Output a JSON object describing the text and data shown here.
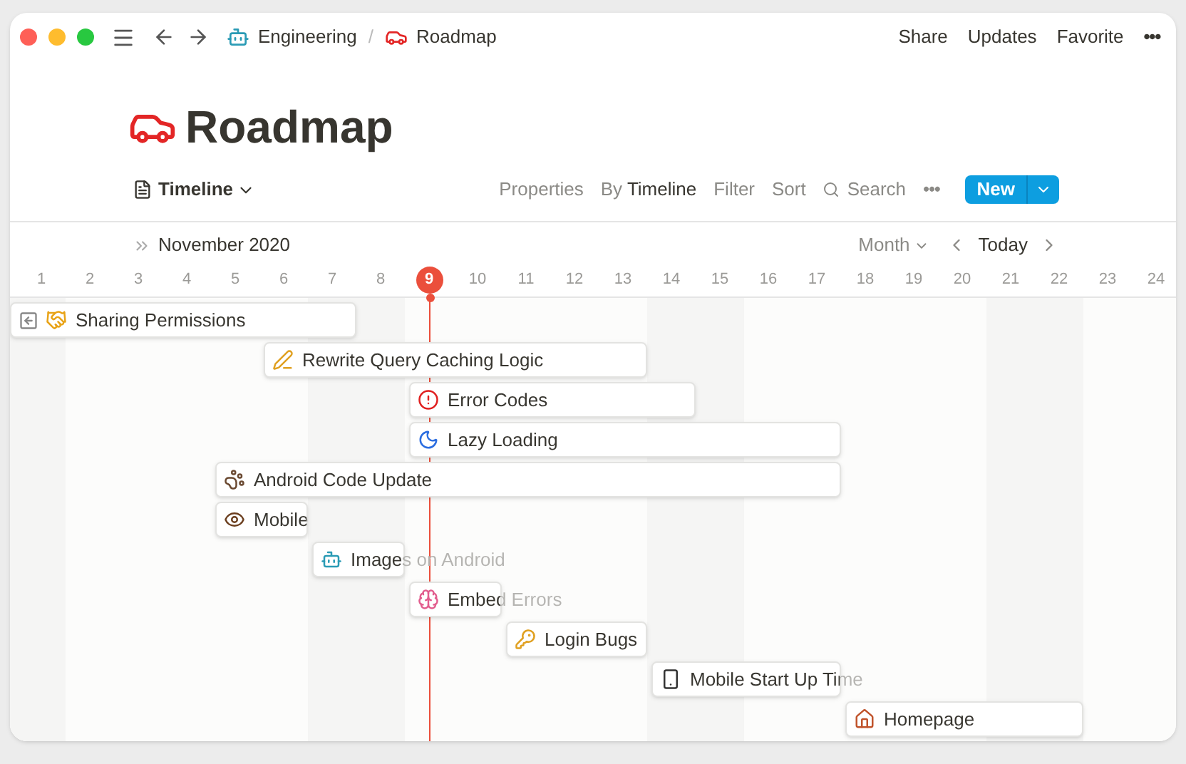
{
  "breadcrumb_separator": "/",
  "breadcrumb": [
    {
      "label": "Engineering"
    },
    {
      "label": "Roadmap"
    }
  ],
  "top_actions": [
    "Share",
    "Updates",
    "Favorite"
  ],
  "more": "•••",
  "title": "Roadmap",
  "view": {
    "label": "Timeline"
  },
  "toolbar": {
    "properties": "Properties",
    "group_prefix": "By",
    "group_value": "Timeline",
    "filter": "Filter",
    "sort": "Sort",
    "search": "Search",
    "more": "•••",
    "new": "New"
  },
  "month": "November 2020",
  "zoom": "Month",
  "today": "Today",
  "days": [
    {
      "label": "1",
      "weekend": true,
      "today": false
    },
    {
      "label": "2",
      "weekend": false,
      "today": false
    },
    {
      "label": "3",
      "weekend": false,
      "today": false
    },
    {
      "label": "4",
      "weekend": false,
      "today": false
    },
    {
      "label": "5",
      "weekend": false,
      "today": false
    },
    {
      "label": "6",
      "weekend": false,
      "today": false
    },
    {
      "label": "7",
      "weekend": true,
      "today": false
    },
    {
      "label": "8",
      "weekend": true,
      "today": false
    },
    {
      "label": "9",
      "weekend": false,
      "today": true
    },
    {
      "label": "10",
      "weekend": false,
      "today": false
    },
    {
      "label": "11",
      "weekend": false,
      "today": false
    },
    {
      "label": "12",
      "weekend": false,
      "today": false
    },
    {
      "label": "13",
      "weekend": false,
      "today": false
    },
    {
      "label": "14",
      "weekend": true,
      "today": false
    },
    {
      "label": "15",
      "weekend": true,
      "today": false
    },
    {
      "label": "16",
      "weekend": false,
      "today": false
    },
    {
      "label": "17",
      "weekend": false,
      "today": false
    },
    {
      "label": "18",
      "weekend": false,
      "today": false
    },
    {
      "label": "19",
      "weekend": false,
      "today": false
    },
    {
      "label": "20",
      "weekend": false,
      "today": false
    },
    {
      "label": "21",
      "weekend": true,
      "today": false
    },
    {
      "label": "22",
      "weekend": true,
      "today": false
    },
    {
      "label": "23",
      "weekend": false,
      "today": false
    },
    {
      "label": "24",
      "weekend": false,
      "today": false
    }
  ],
  "tasks": [
    {
      "title": "Sharing Permissions"
    },
    {
      "title": "Rewrite Query Caching Logic"
    },
    {
      "title": "Error Codes"
    },
    {
      "title": "Lazy Loading"
    },
    {
      "title": "Android Code Update"
    },
    {
      "title": "Mobile"
    },
    {
      "title": "Images on Android"
    },
    {
      "title": "Embed Errors"
    },
    {
      "title": "Login Bugs"
    },
    {
      "title": "Mobile Start Up Time"
    },
    {
      "title": "Homepage"
    }
  ]
}
